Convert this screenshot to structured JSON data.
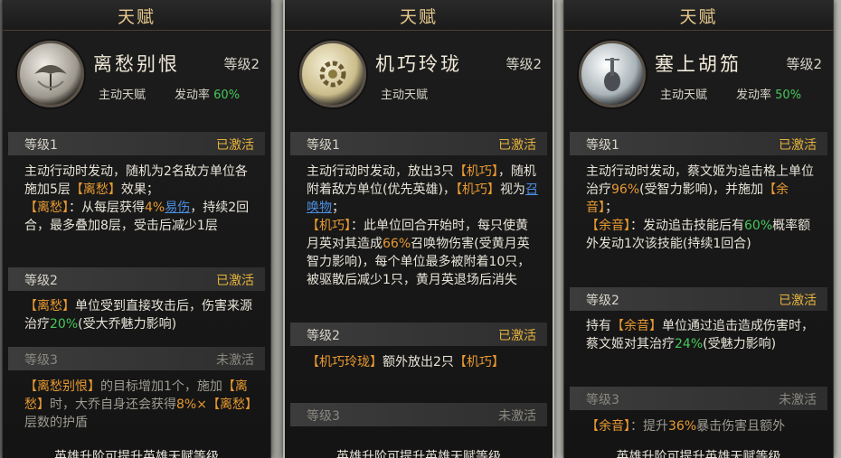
{
  "cards": [
    {
      "title": "天赋",
      "name": "离愁别恨",
      "level": "等级2",
      "type": "主动天赋",
      "rate_label": "发动率",
      "rate_value": "60%",
      "icon": "umbrella-icon",
      "tiers": [
        {
          "label": "等级1",
          "status": "已激活",
          "active": true
        },
        {
          "label": "等级2",
          "status": "已激活",
          "active": true
        },
        {
          "label": "等级3",
          "status": "未激活",
          "active": false
        }
      ],
      "footer": "英雄升阶可提升英雄天赋等级"
    },
    {
      "title": "天赋",
      "name": "机巧玲珑",
      "level": "等级2",
      "type": "主动天赋",
      "icon": "gear-icon",
      "tiers": [
        {
          "label": "等级1",
          "status": "已激活",
          "active": true
        },
        {
          "label": "等级2",
          "status": "已激活",
          "active": true
        },
        {
          "label": "等级3",
          "status": "未激活",
          "active": false
        }
      ],
      "footer": "英雄升阶可提升英雄天赋等级"
    },
    {
      "title": "天赋",
      "name": "塞上胡笳",
      "level": "等级2",
      "type": "主动天赋",
      "rate_label": "发动率",
      "rate_value": "50%",
      "icon": "lute-icon",
      "tiers": [
        {
          "label": "等级1",
          "status": "已激活",
          "active": true
        },
        {
          "label": "等级2",
          "status": "已激活",
          "active": true
        },
        {
          "label": "等级3",
          "status": "未激活",
          "active": false
        }
      ],
      "footer": "英雄升阶可提升英雄天赋等级"
    }
  ],
  "text": {
    "c1_t1_a": "主动行动时发动，随机为2名敌方单位各施加5层",
    "c1_t1_tag": "【离愁】",
    "c1_t1_b": "效果；",
    "c1_t1_c_tag": "【离愁】",
    "c1_t1_c": "：从每层获得",
    "c1_t1_pct": "4%",
    "c1_t1_link": "易伤",
    "c1_t1_d": "，持续2回合，最多叠加8层，受击后减少1层",
    "c1_t2_tag": "【离愁】",
    "c1_t2_a": "单位受到直接攻击后，伤害来源治疗",
    "c1_t2_pct": "20%",
    "c1_t2_b": "(受大乔魅力影响)",
    "c1_t3_tag1": "【离愁别恨】",
    "c1_t3_a": "的目标增加1个，施加",
    "c1_t3_tag2": "【离愁】",
    "c1_t3_b": "时，大乔自身还会获得",
    "c1_t3_pct": "8%×",
    "c1_t3_tag3": "【离愁】",
    "c1_t3_c": "层数的护盾",
    "c2_t1_a": "主动行动时发动，放出3只",
    "c2_t1_tag": "【机巧】",
    "c2_t1_b": "，随机附着敌方单位(优先英雄)，",
    "c2_t1_tag2": "【机巧】",
    "c2_t1_c": "视为",
    "c2_t1_link": "召唤物",
    "c2_t1_d": "；",
    "c2_t1_tag3": "【机巧】",
    "c2_t1_e": "：此单位回合开始时，每只使黄月英对其造成",
    "c2_t1_pct": "66%",
    "c2_t1_f": "召唤物伤害(受黄月英智力影响)，每个单位最多被附着10只，被驱散后减少1只，黄月英退场后消失",
    "c2_t2_tag": "【机巧玲珑】",
    "c2_t2_a": "额外放出2只",
    "c2_t2_tag2": "【机巧】",
    "c3_t1_a": "主动行动时发动，蔡文姬为追击格上单位治疗",
    "c3_t1_pct": "96%",
    "c3_t1_b": "(受智力影响)，并施加",
    "c3_t1_tag": "【余音】",
    "c3_t1_c": "；",
    "c3_t1_tag2": "【余音】",
    "c3_t1_d": "：发动追击技能后有",
    "c3_t1_pct2": "60%",
    "c3_t1_e": "概率额外发动1次该技能(持续1回合)",
    "c3_t2_a": "持有",
    "c3_t2_tag": "【余音】",
    "c3_t2_b": "单位通过追击造成伤害时，蔡文姬对其治疗",
    "c3_t2_pct": "24%",
    "c3_t2_c": "(受魅力影响)",
    "c3_t3_tag": "【余音】",
    "c3_t3_a": "：提升",
    "c3_t3_pct": "36%",
    "c3_t3_b": "暴击伤害且额外"
  },
  "colors": {
    "gold": "#e6c98c",
    "active": "#e7b43c",
    "green": "#46c85a",
    "orange": "#e89a32",
    "link": "#4c8fe0"
  }
}
